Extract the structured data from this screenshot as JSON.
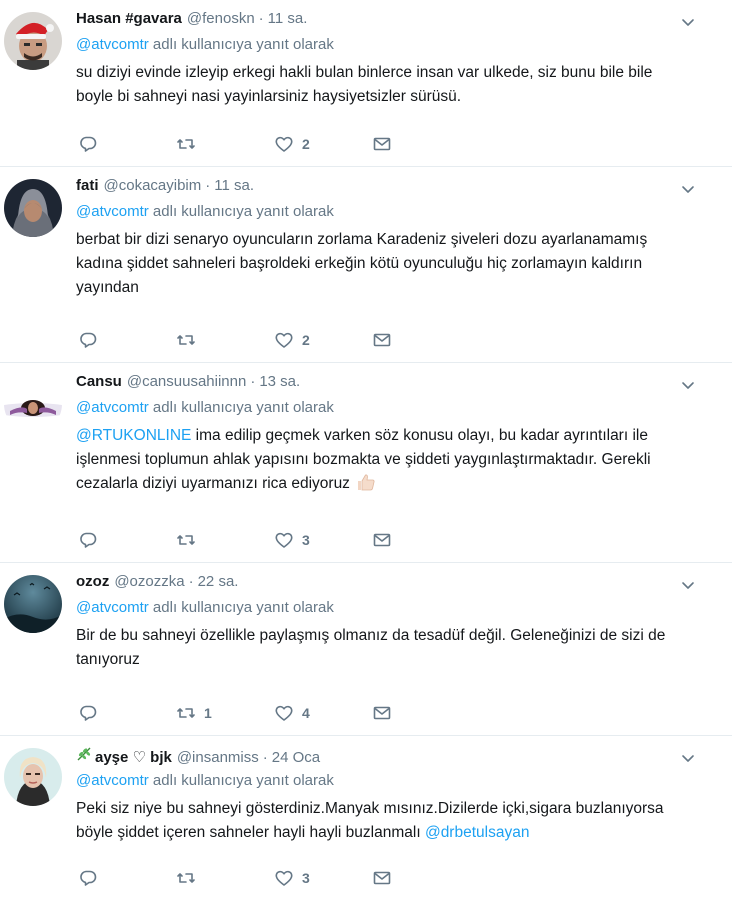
{
  "tweets": [
    {
      "fullname": "Hasan #gavara",
      "handle": "@fenoskn",
      "time": "11 sa.",
      "reply_mention": "@atvcomtr",
      "reply_suffix": "adlı kullanıcıya yanıt olarak",
      "text": "su diziyi evinde izleyip erkegi hakli bulan binlerce insan var ulkede, siz bunu bile bile boyle bi sahneyi nasi yayinlarsiniz haysiyetsizler sürüsü.",
      "retweets": "",
      "likes": "2"
    },
    {
      "fullname": "fati",
      "handle": "@cokacayibim",
      "time": "11 sa.",
      "reply_mention": "@atvcomtr",
      "reply_suffix": "adlı kullanıcıya yanıt olarak",
      "text": "berbat bir dizi senaryo oyuncuların zorlama Karadeniz şiveleri dozu ayarlanamamış kadına şiddet sahneleri başroldeki erkeğin kötü oyunculuğu hiç zorlamayın kaldırın yayından",
      "retweets": "",
      "likes": "2"
    },
    {
      "fullname": "Cansu",
      "handle": "@cansuusahiinnn",
      "time": "13 sa.",
      "reply_mention": "@atvcomtr",
      "reply_suffix": "adlı kullanıcıya yanıt olarak",
      "text_mention": "@RTUKONLINE",
      "text": " ima edilip geçmek varken söz konusu olayı, bu kadar ayrıntıları ile işlenmesi toplumun ahlak yapısını bozmakta ve şiddeti yaygınlaştırmaktadır. Gerekli cezalarla diziyi uyarmanızı rica ediyoruz",
      "retweets": "",
      "likes": "3"
    },
    {
      "fullname": "ozoz",
      "handle": "@ozozzka",
      "time": "22 sa.",
      "reply_mention": "@atvcomtr",
      "reply_suffix": "adlı kullanıcıya yanıt olarak",
      "text": "Bir de bu sahneyi özellikle paylaşmış olmanız da tesadüf değil. Geleneğinizi de sizi de tanıyoruz",
      "retweets": "1",
      "likes": "4"
    },
    {
      "fullname": "ayşe ♡ bjk",
      "handle": "@insanmiss",
      "time": "24 Oca",
      "reply_mention": "@atvcomtr",
      "reply_suffix": "adlı kullanıcıya yanıt olarak",
      "text": "Peki siz niye bu sahneyi gösterdiniz.Manyak mısınız.Dizilerde içki,sigara buzlanıyorsa böyle şiddet içeren sahneler hayli hayli buzlanmalı ",
      "text_mention_end": "@drbetulsayan",
      "retweets": "",
      "likes": "3"
    }
  ],
  "icons": {
    "reply": "reply-icon",
    "retweet": "retweet-icon",
    "like": "heart-icon",
    "dm": "envelope-icon",
    "caret": "chevron-down-icon"
  },
  "colors": {
    "link": "#1da1f2",
    "muted": "#657786",
    "text": "#14171a",
    "border": "#e6ecf0"
  }
}
